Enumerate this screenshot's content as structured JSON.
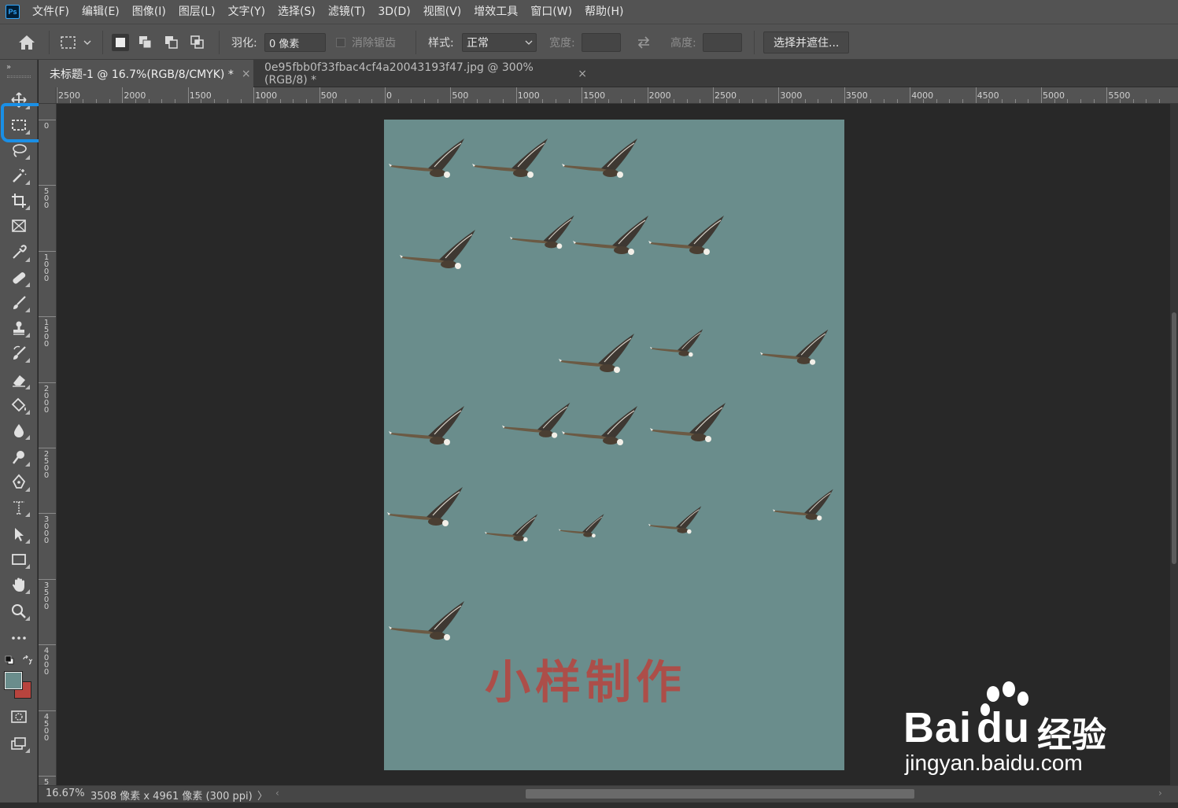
{
  "app": {
    "logo_text": "Ps",
    "menu": [
      "文件(F)",
      "编辑(E)",
      "图像(I)",
      "图层(L)",
      "文字(Y)",
      "选择(S)",
      "滤镜(T)",
      "3D(D)",
      "视图(V)",
      "增效工具",
      "窗口(W)",
      "帮助(H)"
    ]
  },
  "options": {
    "feather_label": "羽化:",
    "feather_value": "0 像素",
    "antialias_label": "消除锯齿",
    "style_label": "样式:",
    "style_value": "正常",
    "width_label": "宽度:",
    "height_label": "高度:",
    "select_mask_button": "选择并遮住..."
  },
  "tabs": [
    {
      "label": "未标题-1 @ 16.7%(RGB/8/CMYK) *",
      "active": true
    },
    {
      "label": "0e95fbb0f33fbac4cf4a20043193f47.jpg @ 300%(RGB/8) *",
      "active": false
    }
  ],
  "rulers": {
    "horizontal": [
      "2500",
      "2000",
      "1500",
      "1000",
      "500",
      "0",
      "500",
      "1000",
      "1500",
      "2000",
      "2500",
      "3000",
      "3500",
      "4000",
      "4500",
      "5000",
      "5500"
    ],
    "vertical": [
      "0",
      "500",
      "1000",
      "1500",
      "2000",
      "2500",
      "3000",
      "3500",
      "4000",
      "4500",
      "5"
    ]
  },
  "document": {
    "background_color": "#6a8d8c",
    "title_text": "小样制作",
    "title_color": "#b8443e"
  },
  "colors": {
    "foreground": "#6a8d8c",
    "background": "#b8443e",
    "selection_highlight": "#1a8fe6"
  },
  "status": {
    "zoom": "16.67%",
    "doc_info": "3508 像素 x 4961 像素 (300 ppi)",
    "arrow": "〉"
  },
  "watermark": {
    "brand_pre": "Bai",
    "brand_post": "du",
    "cn": "经验",
    "url": "jingyan.baidu.com"
  },
  "tools": [
    "move-tool",
    "rectangular-marquee-tool",
    "lasso-tool",
    "magic-wand-tool",
    "crop-tool",
    "frame-tool",
    "eyedropper-tool",
    "healing-brush-tool",
    "brush-tool",
    "clone-stamp-tool",
    "history-brush-tool",
    "eraser-tool",
    "paint-bucket-tool",
    "blur-tool",
    "dodge-tool",
    "pen-tool",
    "type-tool",
    "path-selection-tool",
    "rectangle-tool",
    "hand-tool",
    "zoom-tool",
    "more-tools"
  ]
}
